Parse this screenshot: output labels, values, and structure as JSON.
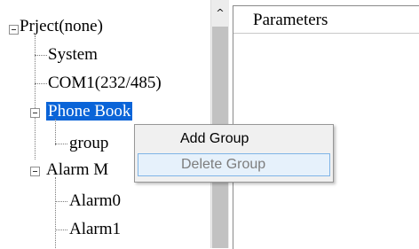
{
  "tree": {
    "root": "Prject(none)",
    "items": [
      {
        "label": "System"
      },
      {
        "label": "COM1(232/485)"
      },
      {
        "label": "Phone Book"
      },
      {
        "label": "group"
      },
      {
        "label": "Alarm M"
      },
      {
        "label": "Alarm0"
      },
      {
        "label": "Alarm1"
      }
    ]
  },
  "scrollbar": {
    "up_arrow": "^"
  },
  "params": {
    "title": "Parameters"
  },
  "context_menu": {
    "add_group": "Add Group",
    "delete_group": "Delete Group"
  }
}
